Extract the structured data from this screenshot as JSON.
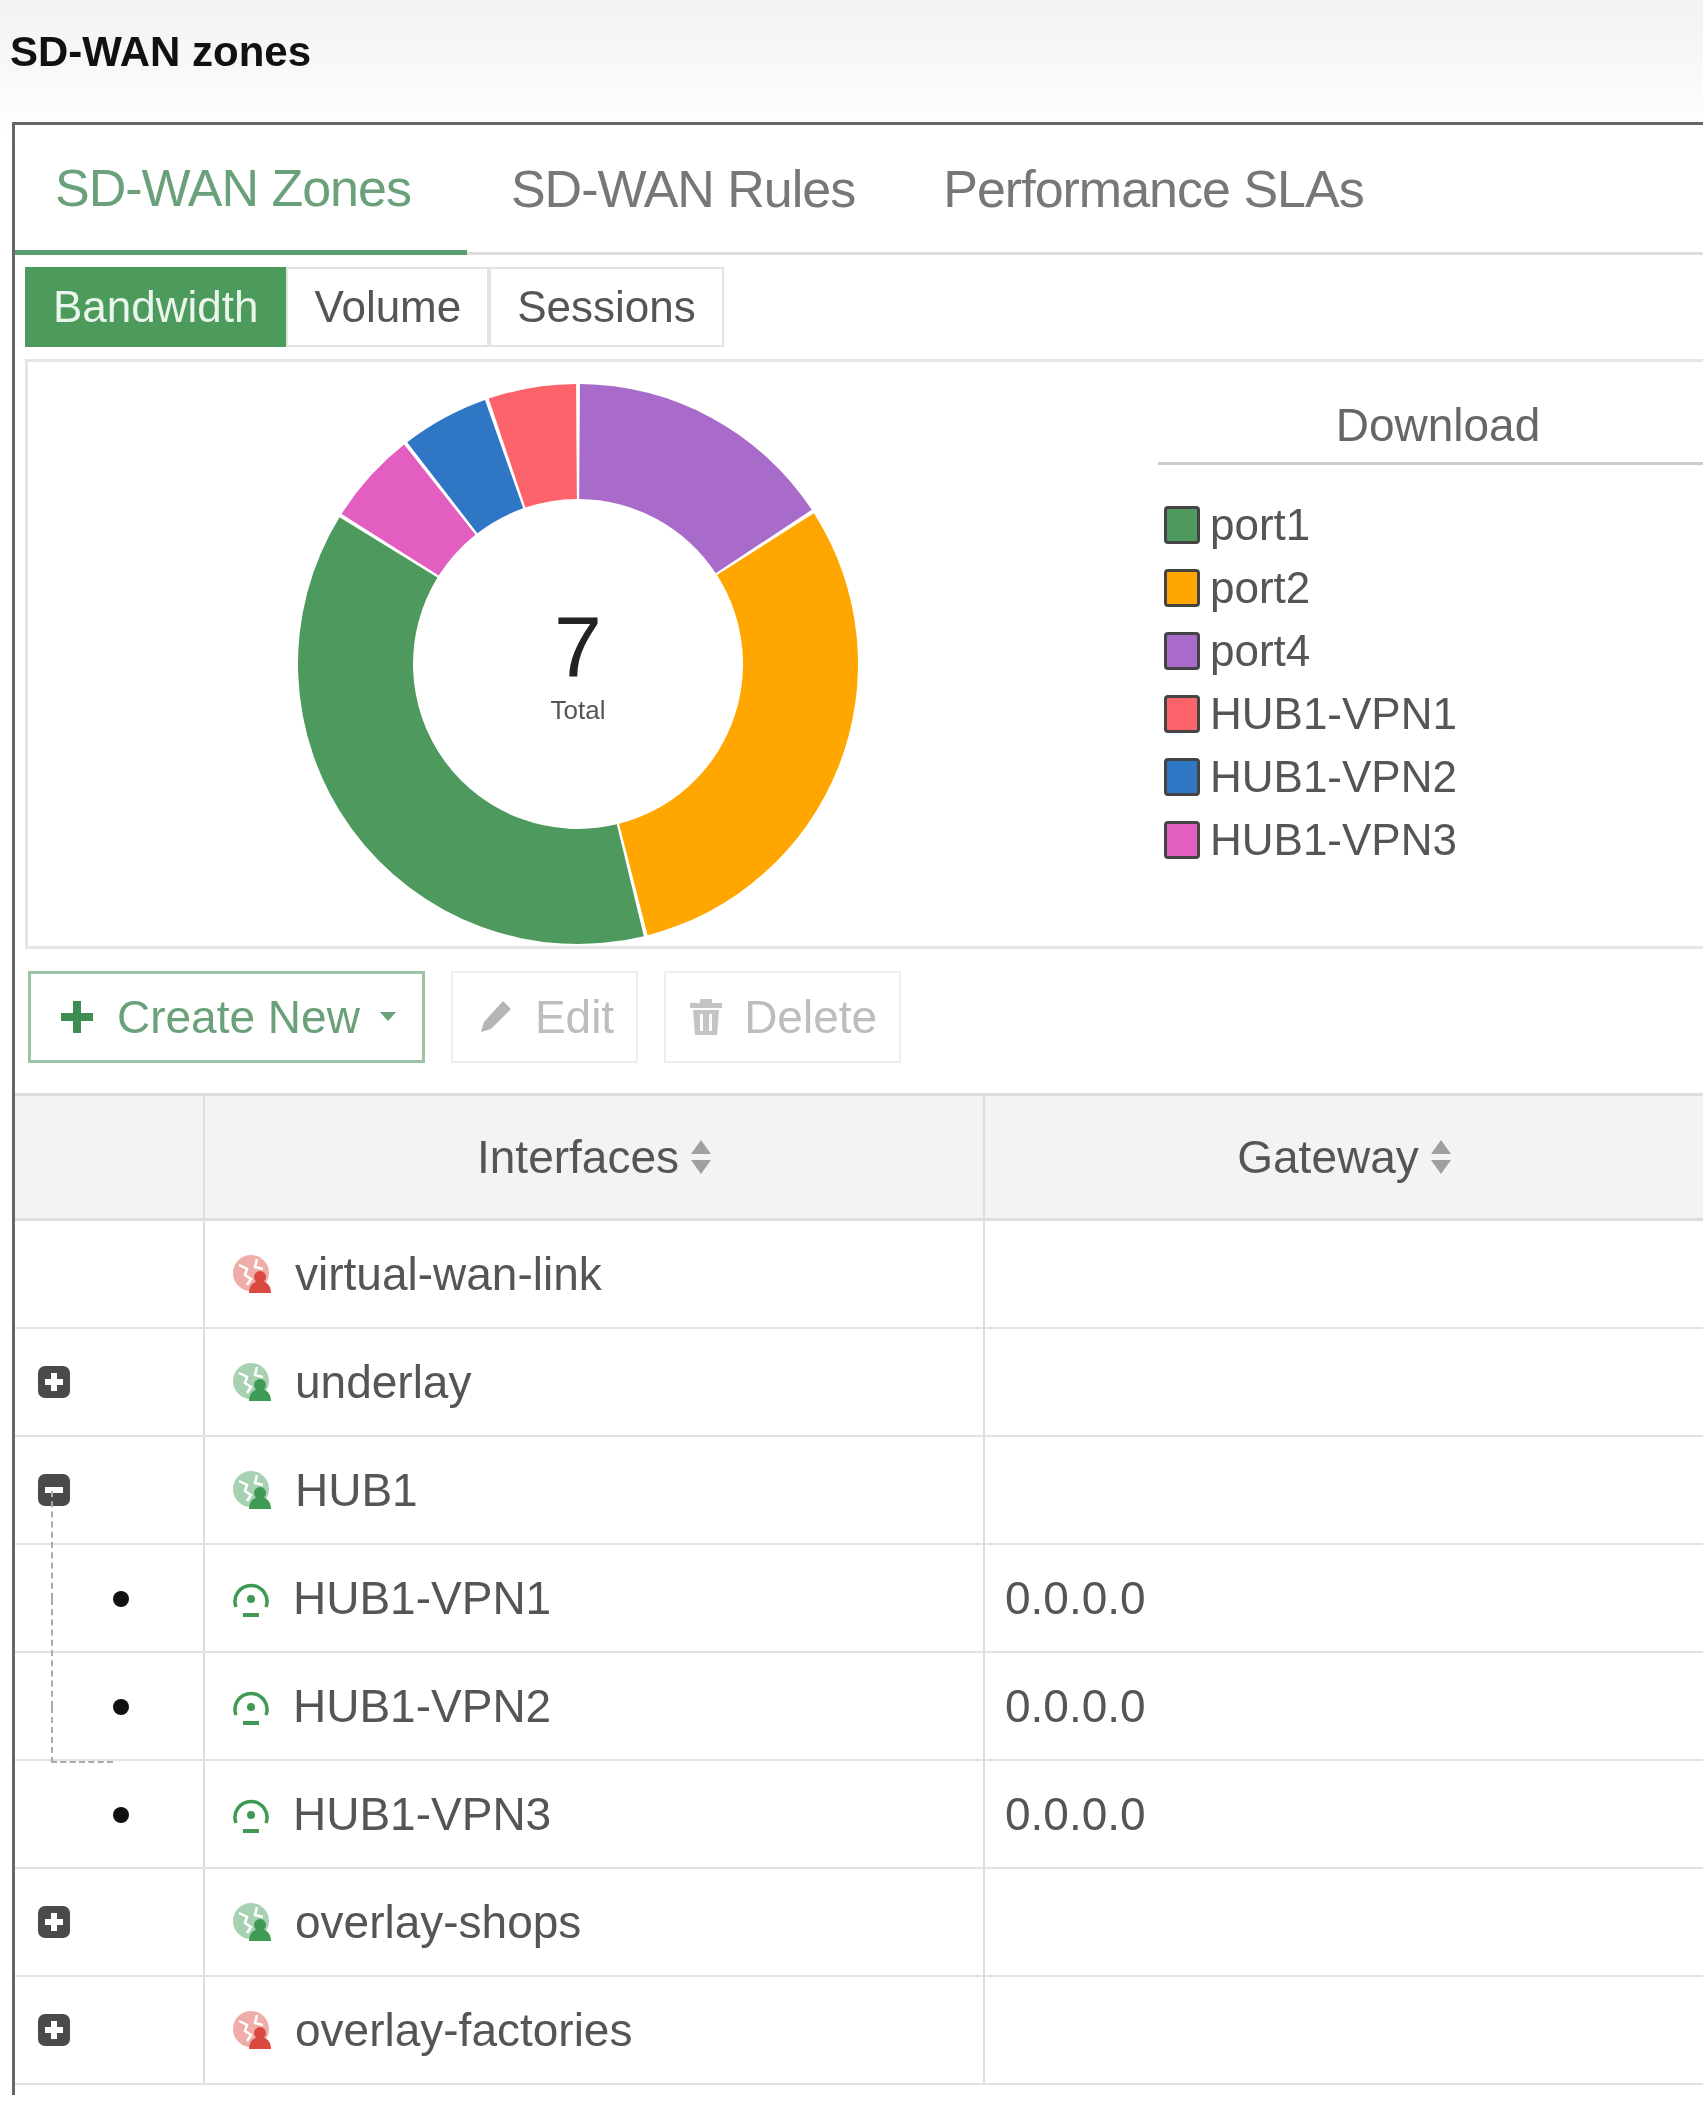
{
  "page_title": "SD-WAN zones",
  "tabs": [
    {
      "label": "SD-WAN Zones",
      "selected": true
    },
    {
      "label": "SD-WAN Rules",
      "selected": false
    },
    {
      "label": "Performance SLAs",
      "selected": false
    }
  ],
  "view_tabs": [
    {
      "label": "Bandwidth",
      "selected": true
    },
    {
      "label": "Volume",
      "selected": false
    },
    {
      "label": "Sessions",
      "selected": false
    }
  ],
  "donut": {
    "total": "7",
    "total_label": "Total"
  },
  "legend": {
    "title": "Download",
    "items": [
      {
        "label": "port1",
        "color": "#4e9a5e"
      },
      {
        "label": "port2",
        "color": "#ffa600"
      },
      {
        "label": "port4",
        "color": "#a96bca"
      },
      {
        "label": "HUB1-VPN1",
        "color": "#fc636b"
      },
      {
        "label": "HUB1-VPN2",
        "color": "#2f76c4"
      },
      {
        "label": "HUB1-VPN3",
        "color": "#e35ec1"
      }
    ]
  },
  "toolbar": [
    {
      "kind": "create",
      "label": "Create New",
      "disabled": false
    },
    {
      "kind": "edit",
      "label": "Edit",
      "disabled": true
    },
    {
      "kind": "delete",
      "label": "Delete",
      "disabled": true
    }
  ],
  "table": {
    "columns": [
      "Interfaces",
      "Gateway"
    ],
    "rows": [
      {
        "name": "virtual-wan-link",
        "color": "#d9493f"
      },
      {
        "name": "underlay",
        "color": "#3f9a55",
        "expanded": false
      },
      {
        "name": "HUB1",
        "color": "#3f9a55",
        "expanded": true,
        "children": [
          {
            "name": "HUB1-VPN1",
            "gateway": "0.0.0.0"
          },
          {
            "name": "HUB1-VPN2",
            "gateway": "0.0.0.0"
          },
          {
            "name": "HUB1-VPN3",
            "gateway": "0.0.0.0"
          }
        ]
      },
      {
        "name": "overlay-shops",
        "color": "#3f9a55",
        "expanded": false
      },
      {
        "name": "overlay-factories",
        "color": "#d9493f",
        "expanded": false
      }
    ]
  }
}
